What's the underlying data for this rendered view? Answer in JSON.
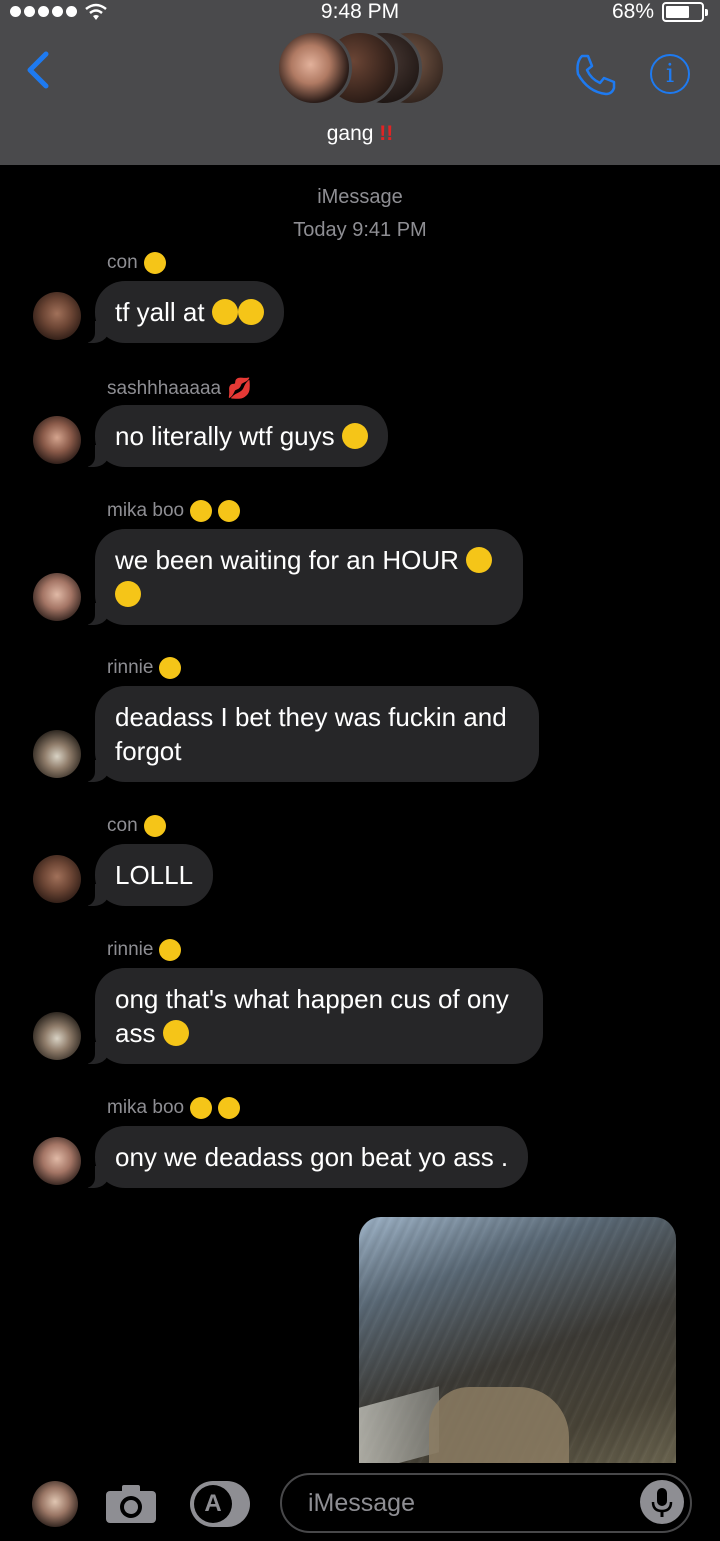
{
  "status_bar": {
    "time": "9:48 PM",
    "battery_percent": "68%",
    "battery_level": 0.68
  },
  "header": {
    "group_name": "gang",
    "group_emoji": "‼️"
  },
  "thread": {
    "service_label": "iMessage",
    "timestamp": "Today 9:41 PM"
  },
  "messages": [
    {
      "sender": "con",
      "text": "tf yall at",
      "sender_emoji": "rolling-eyes",
      "text_emoji": [
        "monocle",
        "monocle"
      ]
    },
    {
      "sender": "sashhhaaaaa",
      "text": "no literally wtf guys",
      "sender_emoji": "kiss-mark",
      "text_emoji": [
        "loudly-crying"
      ]
    },
    {
      "sender": "mika boo",
      "text": "we been waiting for an HOUR",
      "sender_emoji": "heart-eyes x2",
      "text_emoji": [
        "loudly-crying",
        "loudly-crying"
      ]
    },
    {
      "sender": "rinnie",
      "text": "deadass I bet they was fuckin and forgot",
      "sender_emoji": "halo"
    },
    {
      "sender": "con",
      "text": "LOLLL",
      "sender_emoji": "rolling-eyes"
    },
    {
      "sender": "rinnie",
      "text": "ong that's what happen cus of ony ass",
      "sender_emoji": "halo",
      "text_emoji": [
        "loudly-crying"
      ]
    },
    {
      "sender": "mika boo",
      "text": "ony we deadass gon beat yo ass .",
      "sender_emoji": "heart-eyes x2"
    }
  ],
  "composer": {
    "placeholder": "iMessage"
  },
  "colors": {
    "accent": "#1e7af0",
    "bubble": "#262628",
    "header": "#4a4a4c",
    "secondary_text": "#8e8e93",
    "alert": "#e02424"
  },
  "icons": [
    "signal-dots-icon",
    "wifi-icon",
    "battery-icon",
    "back-chevron-icon",
    "phone-icon",
    "info-icon",
    "camera-icon",
    "app-store-icon",
    "microphone-icon"
  ]
}
